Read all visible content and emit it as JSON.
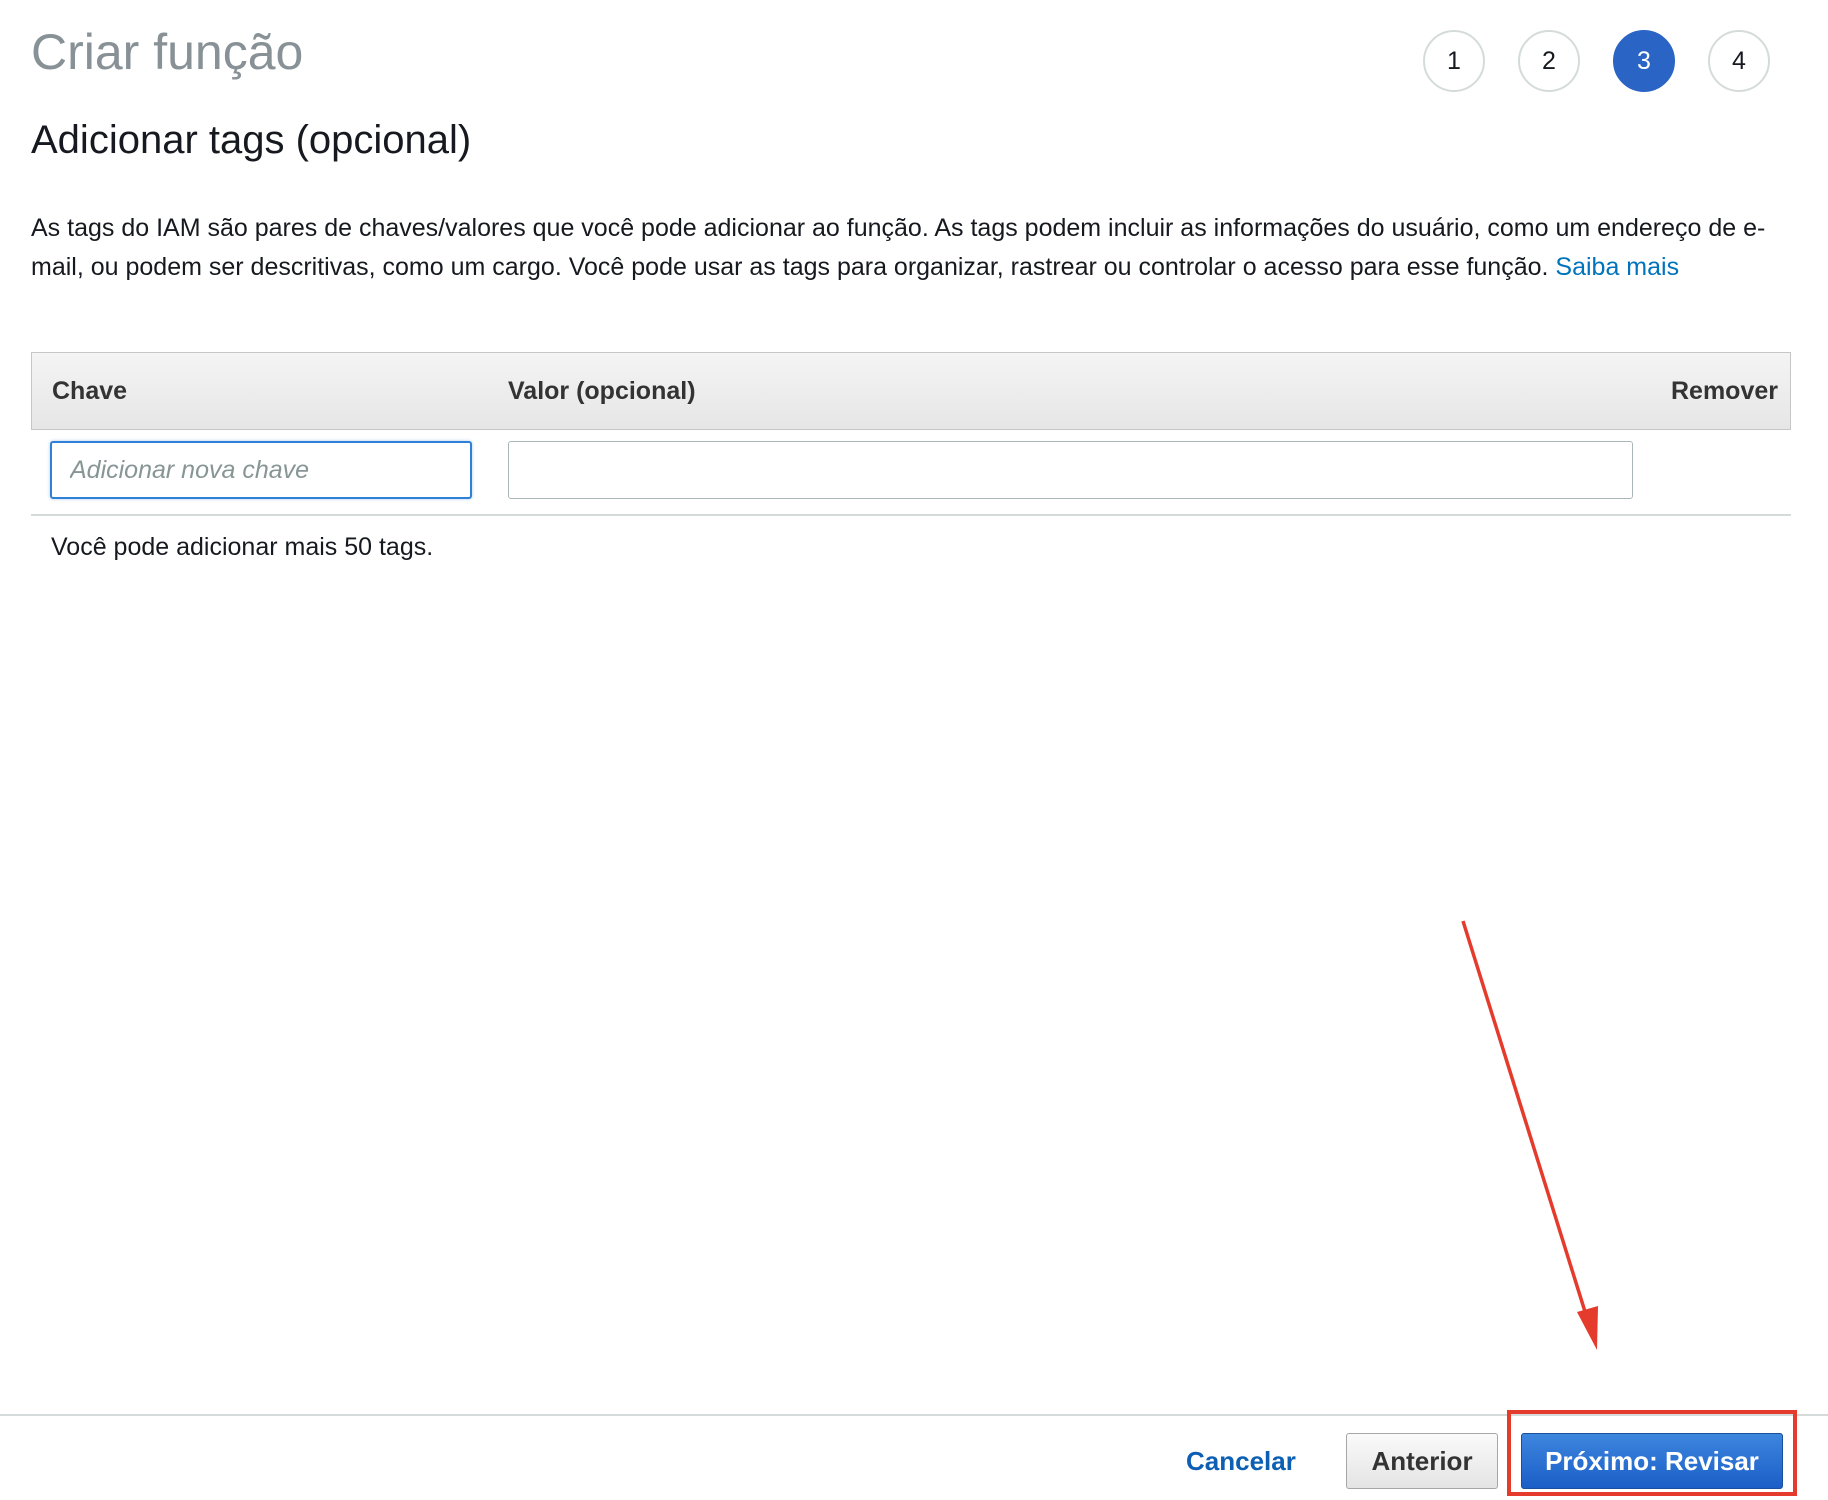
{
  "page": {
    "title": "Criar função"
  },
  "steps": [
    "1",
    "2",
    "3",
    "4"
  ],
  "active_step": "3",
  "section": {
    "title": "Adicionar tags (opcional)",
    "description": "As tags do IAM são pares de chaves/valores que você pode adicionar ao função. As tags podem incluir as informações do usuário, como um endereço de e-mail, ou podem ser descritivas, como um cargo. Você pode usar as tags para organizar, rastrear ou controlar o acesso para esse função.",
    "learn_more": "Saiba mais"
  },
  "table": {
    "headers": {
      "key": "Chave",
      "value": "Valor (opcional)",
      "remove": "Remover"
    },
    "key_placeholder": "Adicionar nova chave",
    "value_input": ""
  },
  "tags_remaining": "Você pode adicionar mais 50 tags.",
  "footer": {
    "cancel": "Cancelar",
    "previous": "Anterior",
    "next": "Próximo: Revisar"
  },
  "colors": {
    "accent": "#2a64c5",
    "link": "#0073bb",
    "annotation": "#e53b2c"
  }
}
